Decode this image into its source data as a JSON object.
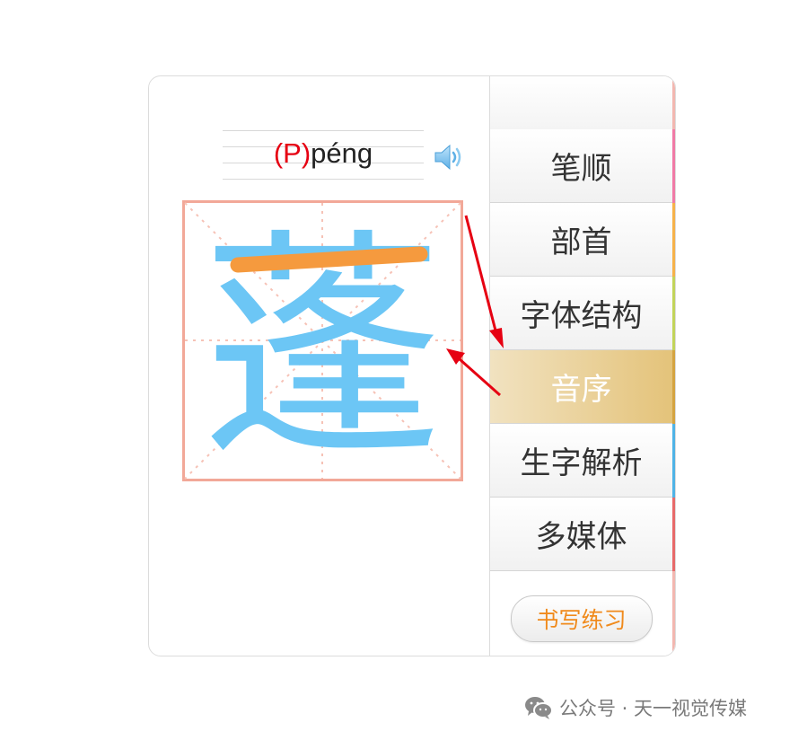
{
  "pinyin": {
    "initial": "(P)",
    "rest": "péng"
  },
  "character": "蓬",
  "menu": {
    "items": [
      {
        "label": "笔顺",
        "accent": "#f07aa6"
      },
      {
        "label": "部首",
        "accent": "#f6b24a"
      },
      {
        "label": "字体结构",
        "accent": "#c2d45a"
      },
      {
        "label": "音序",
        "accent": "#d4a441",
        "active": true
      },
      {
        "label": "生字解析",
        "accent": "#4fb3e6"
      },
      {
        "label": "多媒体",
        "accent": "#e76a6a"
      }
    ],
    "practice_label": "书写练习"
  },
  "colors": {
    "stroke_highlight": "#f59a3e",
    "character_main": "#6cc6f5",
    "grid_border": "#f2a898",
    "arrow": "#e60012",
    "active_bg": "#e4c37a"
  },
  "footer": {
    "text": "公众号 · 天一视觉传媒"
  },
  "icons": {
    "speaker": "speaker-icon",
    "wechat": "wechat-icon"
  }
}
